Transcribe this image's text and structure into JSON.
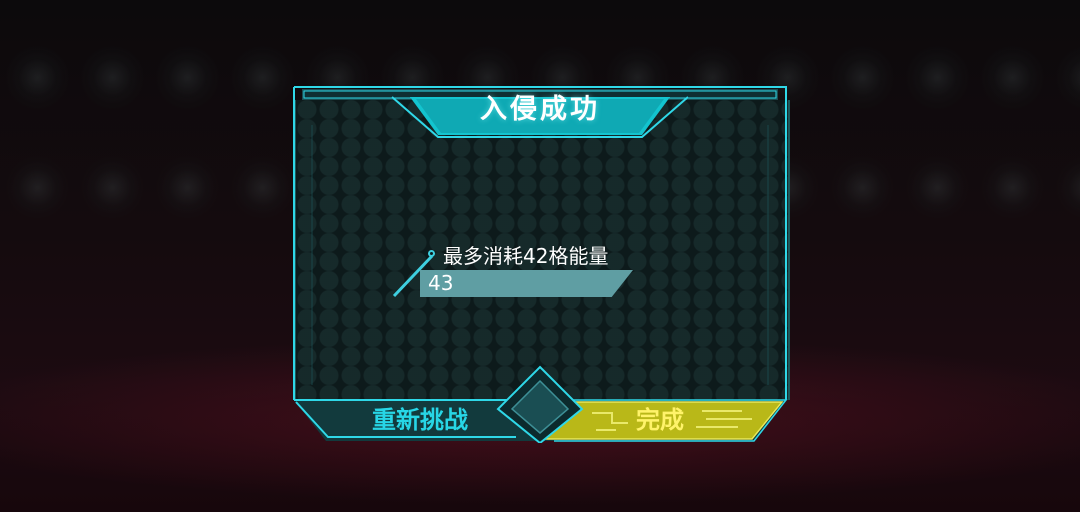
{
  "dialog": {
    "title": "入侵成功",
    "requirement_label": "最多消耗42格能量",
    "energy_value": "43"
  },
  "buttons": {
    "retry_label": "重新挑战",
    "done_label": "完成"
  },
  "colors": {
    "accent_cyan": "#2fd8e8",
    "frame_dark": "#123a3d",
    "done_yellow": "#c8c81a",
    "done_text": "#fff36a",
    "bar_fill": "#5f9ea3"
  }
}
